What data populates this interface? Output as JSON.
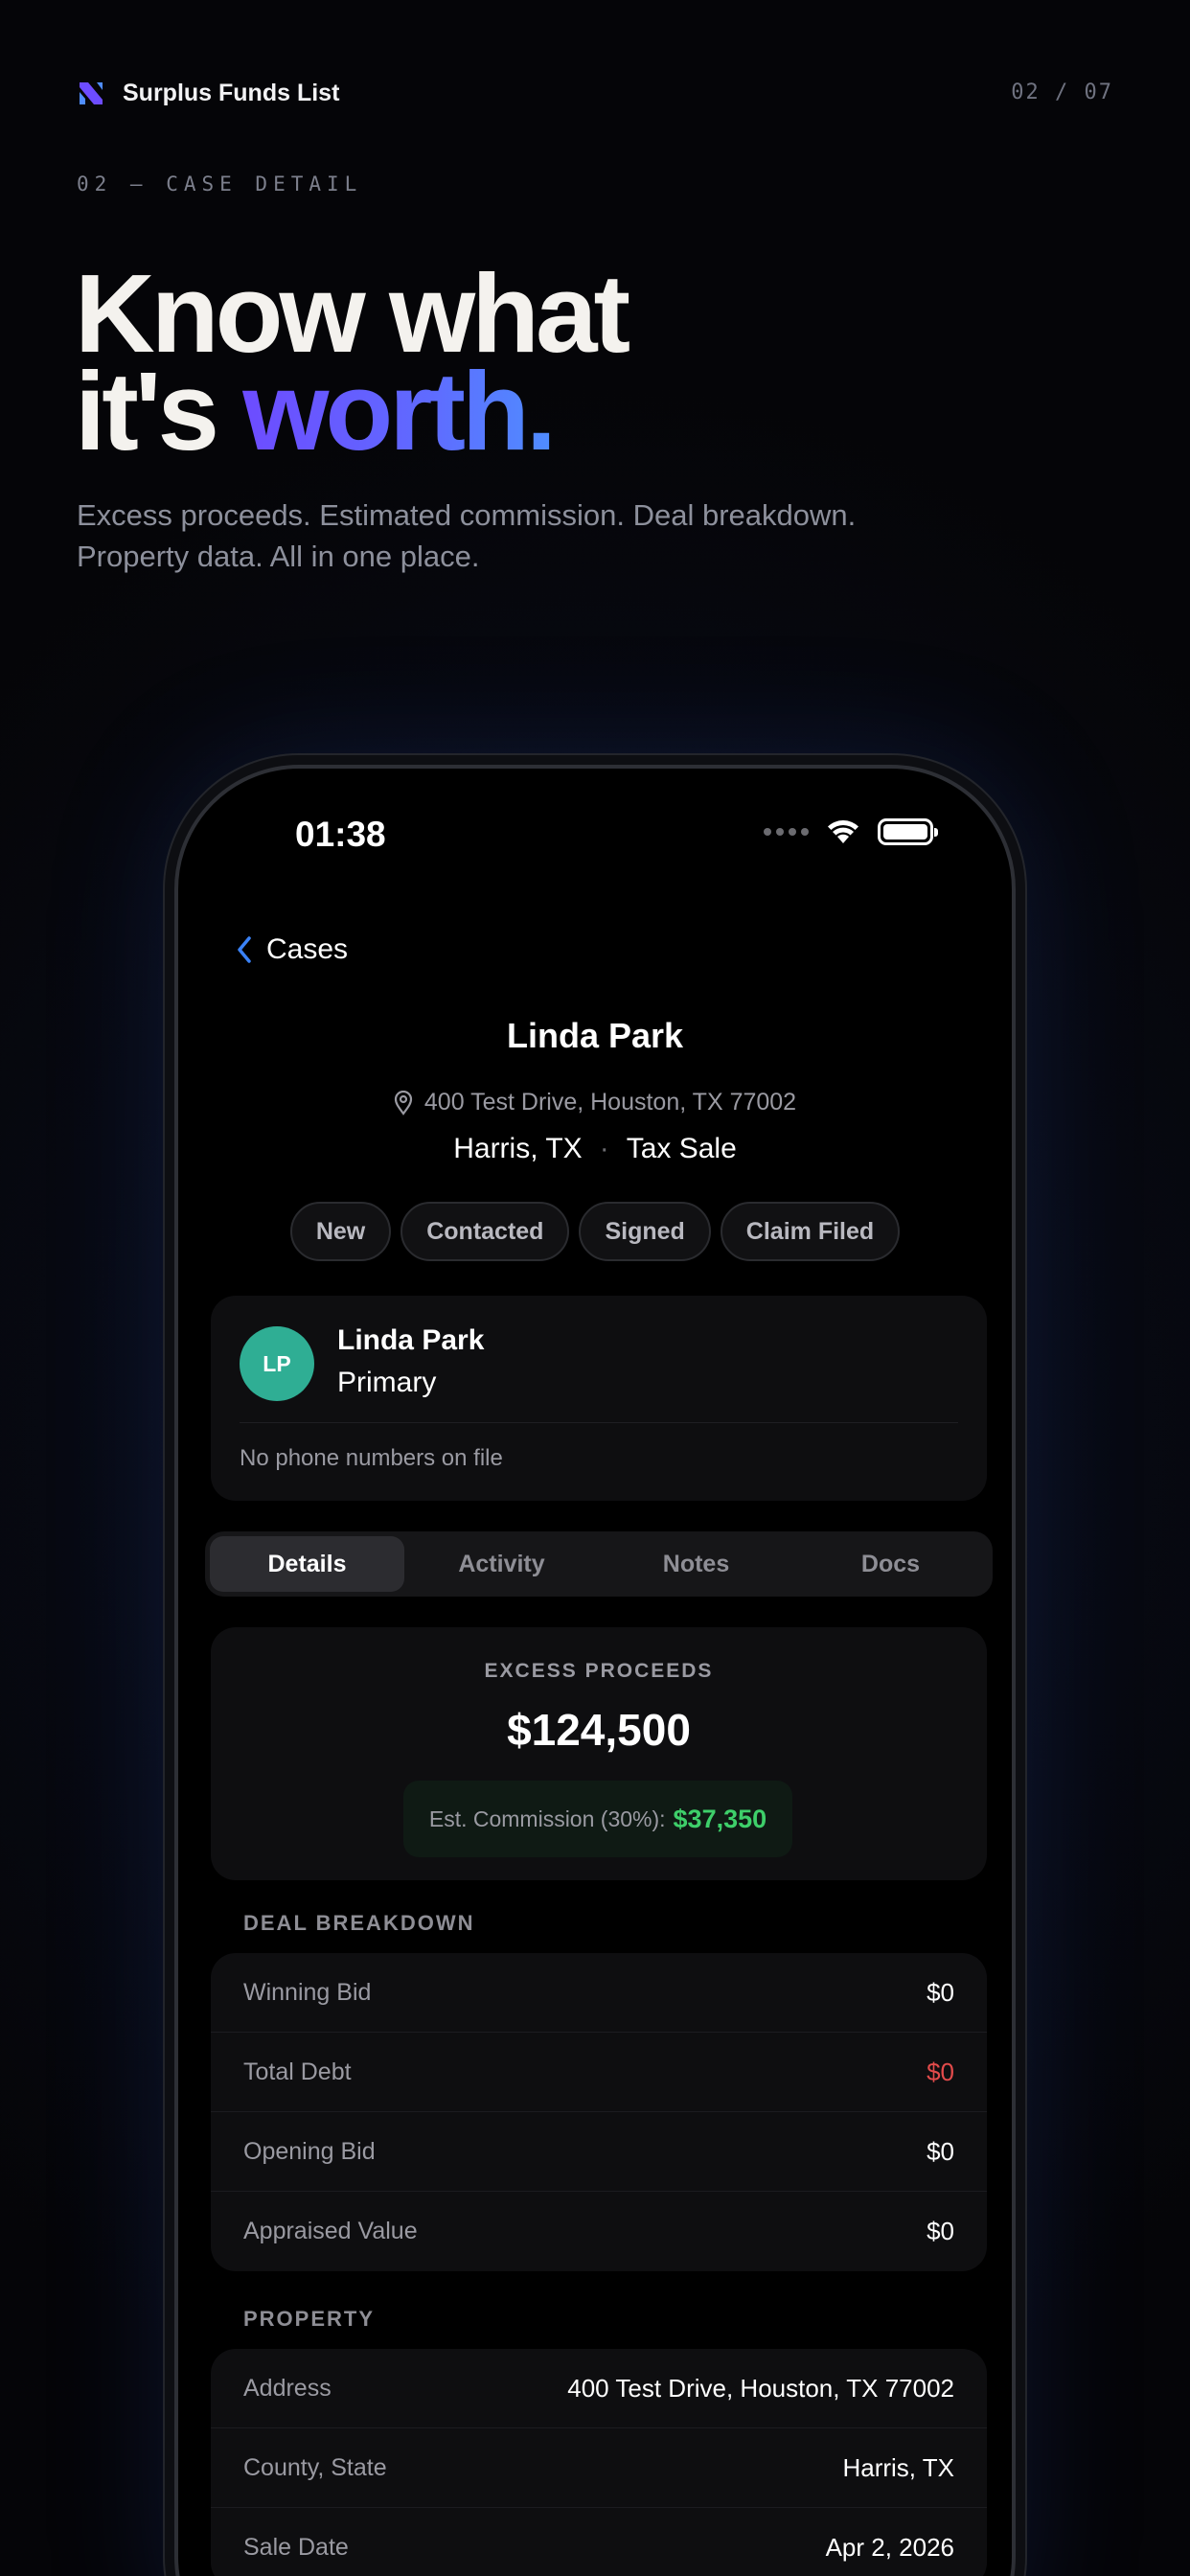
{
  "brand": {
    "name": "Surplus Funds List",
    "logo_icon": "brand-mark-icon"
  },
  "pager": "02 / 07",
  "section_label": "02 — CASE DETAIL",
  "headline": {
    "line1": "Know what",
    "line2_prefix": "it's ",
    "line2_accent": "worth."
  },
  "subhead": {
    "line1": "Excess proceeds. Estimated commission. Deal breakdown.",
    "line2": "Property data. All in one place."
  },
  "status_bar": {
    "time": "01:38"
  },
  "nav": {
    "back_label": "Cases"
  },
  "case": {
    "name": "Linda Park",
    "address": "400 Test Drive, Houston, TX 77002",
    "county": "Harris, TX",
    "sale_type": "Tax Sale"
  },
  "status_chips": [
    "New",
    "Contacted",
    "Signed",
    "Claim Filed"
  ],
  "contact": {
    "initials": "LP",
    "name": "Linda Park",
    "role": "Primary",
    "phone_note": "No phone numbers on file",
    "avatar_color": "#2fae94"
  },
  "tabs": [
    {
      "label": "Details",
      "active": true
    },
    {
      "label": "Activity",
      "active": false
    },
    {
      "label": "Notes",
      "active": false
    },
    {
      "label": "Docs",
      "active": false
    }
  ],
  "proceeds": {
    "label": "EXCESS PROCEEDS",
    "value": "$124,500",
    "commission_label": "Est. Commission (30%):",
    "commission_value": "$37,350"
  },
  "deal_breakdown": {
    "title": "DEAL BREAKDOWN",
    "rows": [
      {
        "label": "Winning Bid",
        "value": "$0"
      },
      {
        "label": "Total Debt",
        "value": "$0"
      },
      {
        "label": "Opening Bid",
        "value": "$0"
      },
      {
        "label": "Appraised Value",
        "value": "$0"
      }
    ]
  },
  "property": {
    "title": "PROPERTY",
    "rows": [
      {
        "label": "Address",
        "value": "400 Test Drive, Houston, TX 77002"
      },
      {
        "label": "County, State",
        "value": "Harris, TX"
      },
      {
        "label": "Sale Date",
        "value": "Apr 2, 2026"
      }
    ]
  },
  "colors": {
    "accent_gradient_start": "#6d4cff",
    "accent_gradient_end": "#4f8dff",
    "commission_green": "#3ecf6a",
    "debt_red": "#e24b4b",
    "link_blue": "#3a82f7"
  }
}
